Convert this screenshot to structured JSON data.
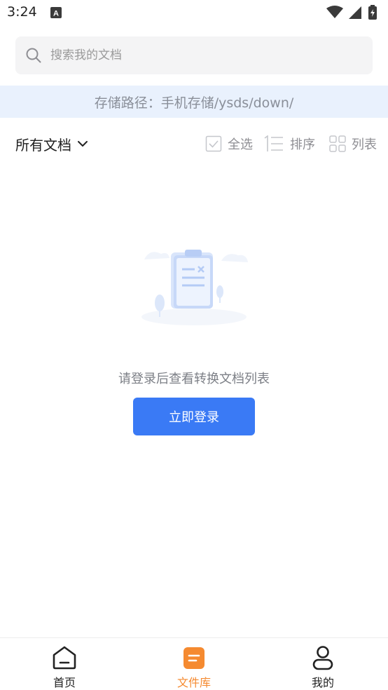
{
  "status_bar": {
    "time": "3:24"
  },
  "search": {
    "placeholder": "搜索我的文档",
    "value": ""
  },
  "path_banner": {
    "text": "存储路径：手机存储/ysds/down/"
  },
  "toolbar": {
    "filter_label": "所有文档",
    "select_all_label": "全选",
    "sort_label": "排序",
    "view_label": "列表"
  },
  "empty_state": {
    "message": "请登录后查看转换文档列表",
    "login_button_label": "立即登录"
  },
  "bottom_nav": {
    "items": [
      {
        "label": "首页",
        "icon": "home-icon",
        "active": false
      },
      {
        "label": "文件库",
        "icon": "library-icon",
        "active": true
      },
      {
        "label": "我的",
        "icon": "user-icon",
        "active": false
      }
    ]
  },
  "colors": {
    "accent": "#3a7af5",
    "active_tab": "#f58a30",
    "banner_bg": "#e9f1fd"
  }
}
